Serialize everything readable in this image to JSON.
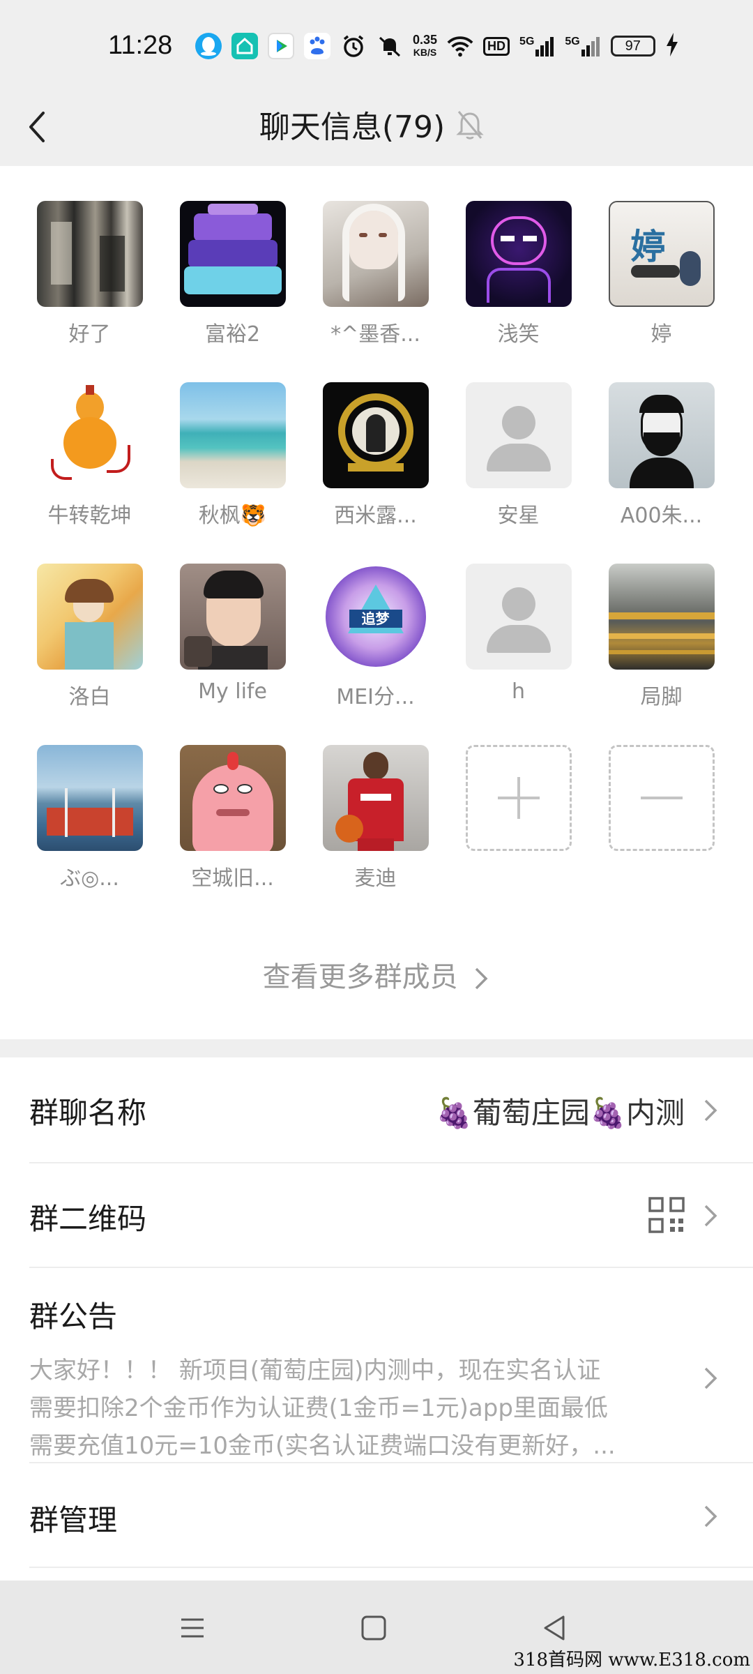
{
  "status_bar": {
    "time": "11:28",
    "net_speed_value": "0.35",
    "net_speed_unit": "KB/S",
    "hd_label": "HD",
    "signal1_label": "5G",
    "signal2_label": "5G",
    "battery": "97",
    "icons": [
      "qq-icon",
      "smart-home-icon",
      "video-icon",
      "baidu-icon",
      "alarm-icon",
      "mute-icon",
      "wifi-icon",
      "hd-icon",
      "signal-icon",
      "signal-icon",
      "battery-icon",
      "charging-icon"
    ]
  },
  "header": {
    "title": "聊天信息(79)",
    "icons": [
      "back-arrow-icon",
      "bell-off-icon"
    ]
  },
  "members": [
    {
      "name": "好了",
      "avatar": "server-room"
    },
    {
      "name": "富裕2",
      "avatar": "cake"
    },
    {
      "name": "*^墨香...",
      "avatar": "anime-girl"
    },
    {
      "name": "浅笑",
      "avatar": "neon-figure"
    },
    {
      "name": "婷",
      "avatar": "cartoon-text"
    },
    {
      "name": "牛转乾坤",
      "avatar": "gourd"
    },
    {
      "name": "秋枫🐯",
      "avatar": "beach"
    },
    {
      "name": "西米露...",
      "avatar": "gold-emblem"
    },
    {
      "name": "安星",
      "avatar": "default"
    },
    {
      "name": "A00朱...",
      "avatar": "bearded-man"
    },
    {
      "name": "洛白",
      "avatar": "painted-boy"
    },
    {
      "name": "My life",
      "avatar": "young-man"
    },
    {
      "name": "MEI分...",
      "avatar": "dream-logo"
    },
    {
      "name": "h",
      "avatar": "default"
    },
    {
      "name": "局脚",
      "avatar": "bikes"
    },
    {
      "name": "ぶ◎...",
      "avatar": "pier"
    },
    {
      "name": "空城旧...",
      "avatar": "patrick"
    },
    {
      "name": "麦迪",
      "avatar": "basketball"
    }
  ],
  "member_actions": {
    "add_icon": "plus-icon",
    "remove_icon": "minus-icon"
  },
  "view_more": "查看更多群成员",
  "settings": {
    "group_name_label": "群聊名称",
    "group_name_value": "🍇葡萄庄园🍇内测",
    "qr_label": "群二维码",
    "qr_icon": "qr-code-icon",
    "notice_label": "群公告",
    "notice_lines": [
      "大家好！！！ 新项目(葡萄庄园)内测中，现在实名认证",
      "需要扣除2个金币作为认证费(1金币=1元)app里面最低",
      "需要充值10元=10金币(实名认证费端口没有更新好，..."
    ],
    "manage_label": "群管理"
  },
  "navbar": {
    "icons": [
      "menu-icon",
      "home-square-icon",
      "back-triangle-icon"
    ]
  },
  "watermark": "318首码网 www.E318.com",
  "colors": {
    "background": "#f0f0f0",
    "card": "#ffffff",
    "secondary_text": "#8c8c8c",
    "divider": "#ededed"
  }
}
